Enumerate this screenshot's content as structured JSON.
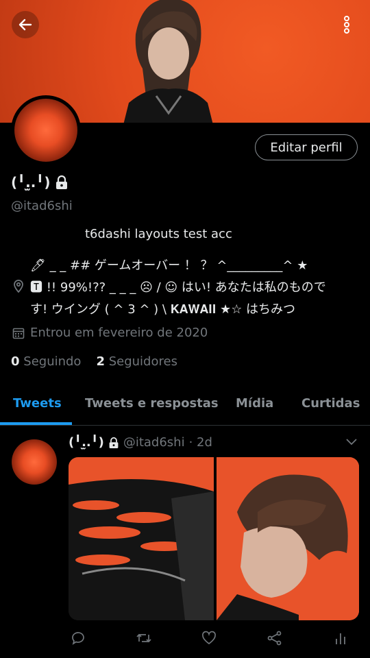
{
  "profile": {
    "name": "(╹.̫.╹)",
    "handle": "@itad6shi",
    "edit_label": "Editar perfil",
    "bio_line1": "t6dashi layouts test acc",
    "bio_line2": "🖊 _ _ ## ゲームオーバー ！ ？ ^_________^ ★",
    "bio_line3": "🆃 !! 99%!?? _ _ _ ☹ / ☺ はい! あなたは私のもので",
    "bio_line4": "す! ウイング ( ^ 3 ^ ) \\ 𝐊𝐀𝐖𝐀𝐈𝐈 ★☆ はちみつ",
    "joined": "Entrou em fevereiro de 2020",
    "following_count": "0",
    "following_label": "Seguindo",
    "followers_count": "2",
    "followers_label": "Seguidores"
  },
  "tabs": [
    {
      "label": "Tweets",
      "active": true
    },
    {
      "label": "Tweets e respostas",
      "active": false
    },
    {
      "label": "Mídia",
      "active": false
    },
    {
      "label": "Curtidas",
      "active": false
    }
  ],
  "tweet": {
    "name": "(╹.̫.╹)",
    "handle": "@itad6shi",
    "time": "· 2d"
  },
  "icons": {
    "back": "arrow-left-icon",
    "more": "more-vertical-icon",
    "lock": "lock-icon",
    "location": "location-pin-icon",
    "calendar": "calendar-icon",
    "reply": "reply-icon",
    "retweet": "retweet-icon",
    "like": "heart-icon",
    "share": "share-icon",
    "analytics": "analytics-icon"
  },
  "colors": {
    "accent": "#1d9bf0",
    "banner": "#e24a1c",
    "muted": "#71767b"
  }
}
